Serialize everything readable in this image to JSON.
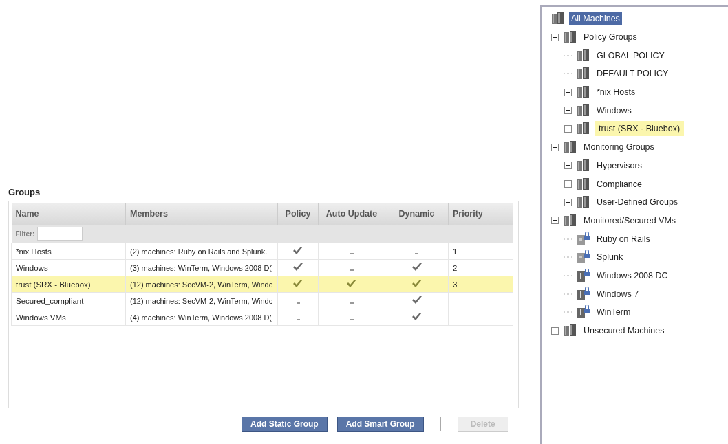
{
  "groups": {
    "title": "Groups",
    "columns": [
      "Name",
      "Members",
      "Policy",
      "Auto Update",
      "Dynamic",
      "Priority"
    ],
    "filter": {
      "label": "Filter:"
    },
    "rows": [
      {
        "name": "*nix Hosts",
        "members": "(2) machines: Ruby on Rails and Splunk.",
        "policy": true,
        "auto_update": false,
        "dynamic": false,
        "priority": "1",
        "highlighted": false
      },
      {
        "name": "Windows",
        "members": "(3) machines: WinTerm, Windows 2008 D(",
        "policy": true,
        "auto_update": false,
        "dynamic": true,
        "priority": "2",
        "highlighted": false
      },
      {
        "name": "trust (SRX - Bluebox)",
        "members": "(12) machines: SecVM-2, WinTerm, Windc",
        "policy": true,
        "auto_update": true,
        "dynamic": true,
        "priority": "3",
        "highlighted": true
      },
      {
        "name": "Secured_compliant",
        "members": "(12) machines: SecVM-2, WinTerm, Windc",
        "policy": false,
        "auto_update": false,
        "dynamic": true,
        "highlighted": false
      },
      {
        "name": "Windows VMs",
        "members": "(4) machines: WinTerm, Windows 2008 D(",
        "policy": false,
        "auto_update": false,
        "dynamic": true,
        "highlighted": false
      }
    ],
    "buttons": [
      {
        "label": "Add Static Group",
        "disabled": false
      },
      {
        "label": "Add Smart Group",
        "disabled": false
      },
      {
        "label": "Delete",
        "disabled": true
      }
    ]
  },
  "tree": [
    {
      "label": "All Machines",
      "kind": "group",
      "selected": true,
      "highlighted": false,
      "children": [
        {
          "label": "Policy Groups",
          "kind": "group",
          "selected": false,
          "highlighted": false,
          "expanded": true,
          "children": [
            {
              "label": "GLOBAL POLICY",
              "kind": "group",
              "selected": false,
              "highlighted": false
            },
            {
              "label": "DEFAULT POLICY",
              "kind": "group",
              "selected": false,
              "highlighted": false
            },
            {
              "label": "*nix Hosts",
              "kind": "group",
              "selected": false,
              "highlighted": false,
              "expanded": false
            },
            {
              "label": "Windows",
              "kind": "group",
              "selected": false,
              "highlighted": false,
              "expanded": false
            },
            {
              "label": "trust (SRX - Bluebox)",
              "kind": "group",
              "selected": false,
              "highlighted": true,
              "expanded": false
            }
          ]
        },
        {
          "label": "Monitoring Groups",
          "kind": "group",
          "selected": false,
          "highlighted": false,
          "expanded": true,
          "children": [
            {
              "label": "Hypervisors",
              "kind": "group",
              "selected": false,
              "highlighted": false,
              "expanded": false
            },
            {
              "label": "Compliance",
              "kind": "group",
              "selected": false,
              "highlighted": false,
              "expanded": false
            },
            {
              "label": "User-Defined Groups",
              "kind": "group",
              "selected": false,
              "highlighted": false,
              "expanded": false
            }
          ]
        },
        {
          "label": "Monitored/Secured VMs",
          "kind": "group",
          "selected": false,
          "highlighted": false,
          "expanded": true,
          "children": [
            {
              "label": "Ruby on Rails",
              "kind": "vm_unknown",
              "selected": false,
              "highlighted": false
            },
            {
              "label": "Splunk",
              "kind": "vm_unknown",
              "selected": false,
              "highlighted": false
            },
            {
              "label": "Windows 2008 DC",
              "kind": "vm",
              "selected": false,
              "highlighted": false
            },
            {
              "label": "Windows 7",
              "kind": "vm",
              "selected": false,
              "highlighted": false
            },
            {
              "label": "WinTerm",
              "kind": "vm",
              "selected": false,
              "highlighted": false
            }
          ]
        },
        {
          "label": "Unsecured Machines",
          "kind": "group",
          "selected": false,
          "highlighted": false,
          "expanded": false
        }
      ]
    }
  ]
}
